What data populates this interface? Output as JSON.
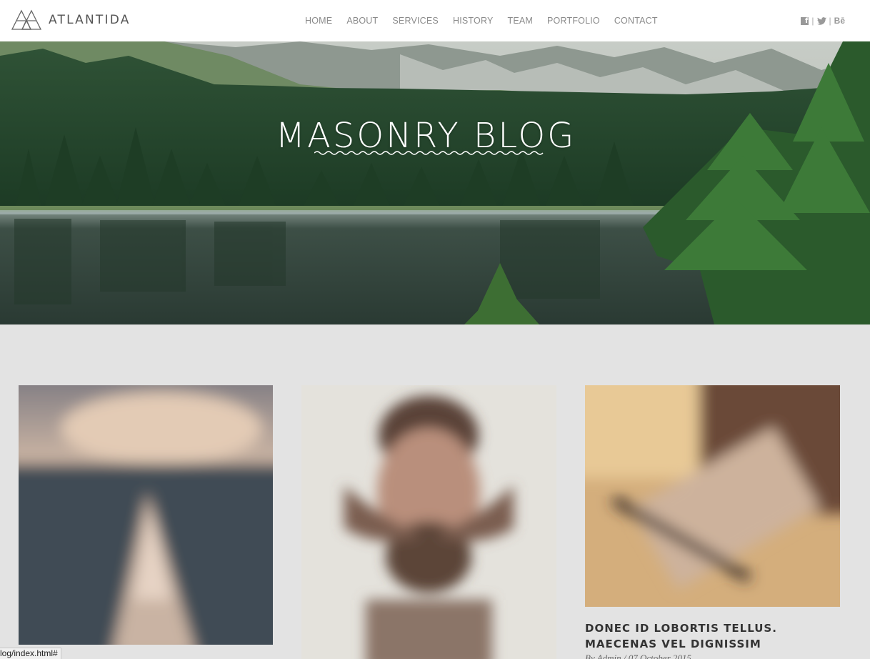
{
  "brand": {
    "name": "ATLANTIDA"
  },
  "nav": {
    "items": [
      "HOME",
      "ABOUT",
      "SERVICES",
      "HISTORY",
      "TEAM",
      "PORTFOLIO",
      "CONTACT"
    ]
  },
  "social": {
    "separator": "|",
    "behance_label": "Bē"
  },
  "hero": {
    "title": "MASONRY BLOG"
  },
  "posts": [
    {
      "title": "",
      "meta": ""
    },
    {
      "title": "",
      "meta": ""
    },
    {
      "title": "DONEC ID LOBORTIS TELLUS. MAECENAS VEL DIGNISSIM",
      "meta": "By Admin / 07 October 2015"
    }
  ],
  "status_bar": {
    "url": "log/index.html#"
  },
  "colors": {
    "header_bg": "#ffffff",
    "page_bg": "#e3e3e3",
    "nav_text": "#8a8a8a",
    "title_text": "#333333"
  }
}
